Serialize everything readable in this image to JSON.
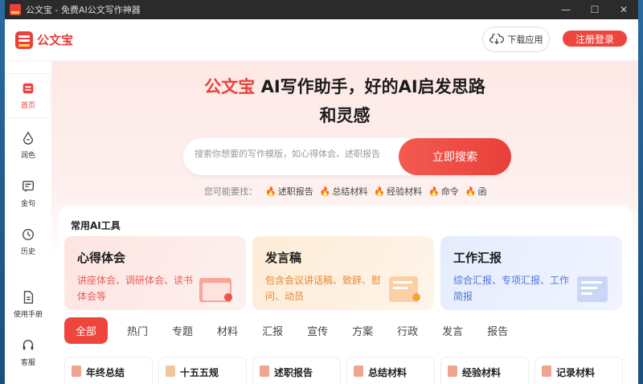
{
  "window": {
    "title": "公文宝 - 免费AI公文写作神器",
    "controls": [
      "—",
      "☐",
      "✕"
    ]
  },
  "header": {
    "logo_text": "公文宝",
    "download_label": "下载应用",
    "register_label": "注册登录"
  },
  "sidebar": {
    "items": [
      {
        "label": "首页",
        "icon": "home-icon"
      },
      {
        "label": "润色",
        "icon": "polish-icon"
      },
      {
        "label": "金句",
        "icon": "quote-icon"
      },
      {
        "label": "历史",
        "icon": "history-icon"
      },
      {
        "label": "使用手册",
        "icon": "manual-icon"
      },
      {
        "label": "客服",
        "icon": "headset-icon"
      }
    ]
  },
  "hero": {
    "brand": "公文宝",
    "title_rest": " AI写作助手，好的AI启发思路",
    "title_line2": "和灵感",
    "search_placeholder": "搜索你想要的写作模版，如心得体会、述职报告",
    "search_button": "立即搜索",
    "hint_label": "您可能要找：",
    "hints": [
      "述职报告",
      "总结材料",
      "经验材料",
      "命令",
      "函"
    ]
  },
  "tools": {
    "title": "常用AI工具",
    "cards": [
      {
        "title": "心得体会",
        "desc": "讲座体会、调研体会、读书体会等"
      },
      {
        "title": "发言稿",
        "desc": "包含会议讲话稿、致辞、慰问、动员"
      },
      {
        "title": "工作汇报",
        "desc": "综合汇报、专项汇报、工作简报"
      }
    ]
  },
  "categories": [
    "全部",
    "热门",
    "专题",
    "材料",
    "汇报",
    "宣传",
    "方案",
    "行政",
    "发言",
    "报告"
  ],
  "docs": [
    "年终总结",
    "十五五规",
    "述职报告",
    "总结材料",
    "经验材料",
    "记录材料"
  ],
  "colors": {
    "accent": "#e8413a",
    "orange": "#e8862e",
    "blue": "#4e76d8"
  }
}
